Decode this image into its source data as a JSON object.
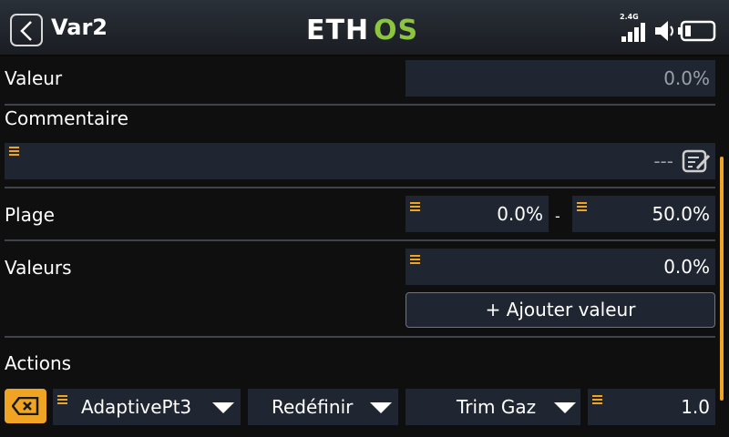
{
  "header": {
    "title": "Var2",
    "logo_text": "ETHOS",
    "rssi_label": "2.4G"
  },
  "valeur": {
    "label": "Valeur",
    "value": "0.0%"
  },
  "commentaire": {
    "label": "Commentaire",
    "value": "---"
  },
  "plage": {
    "label": "Plage",
    "min": "0.0%",
    "separator": "-",
    "max": "50.0%"
  },
  "valeurs": {
    "label": "Valeurs",
    "value": "0.0%",
    "add_button": "+ Ajouter valeur"
  },
  "actions": {
    "label": "Actions",
    "source": "AdaptivePt3",
    "mode": "Redéfinir",
    "target": "Trim Gaz",
    "value": "1.0"
  },
  "colors": {
    "accent": "#f0a423",
    "field_bg": "#202631",
    "logo_green": "#8cc63f"
  }
}
